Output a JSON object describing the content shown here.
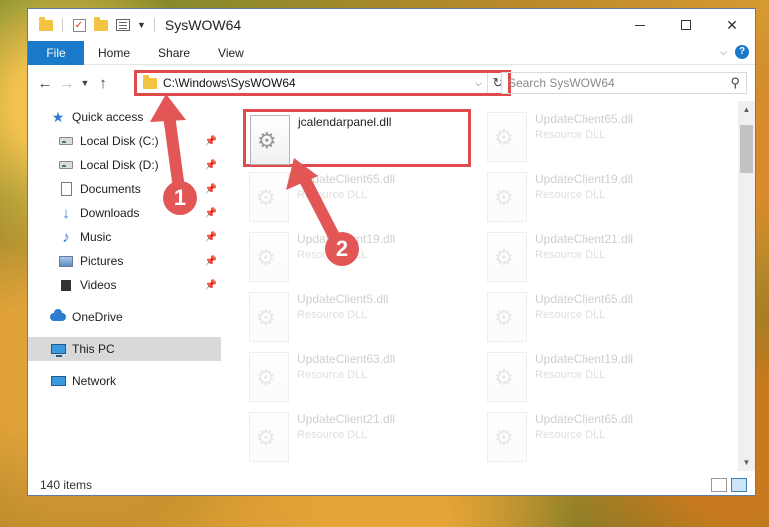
{
  "window": {
    "title": "SysWOW64",
    "minimize_label": "minimize",
    "maximize_label": "maximize",
    "close_label": "✕"
  },
  "ribbon": {
    "file": "File",
    "tabs": [
      "Home",
      "Share",
      "View"
    ]
  },
  "address": {
    "path": "C:\\Windows\\SysWOW64"
  },
  "search": {
    "placeholder": "Search SysWOW64"
  },
  "sidebar": {
    "items": [
      {
        "label": "Quick access",
        "icon": "star-icon"
      },
      {
        "label": "Local Disk (C:)",
        "icon": "drive-icon"
      },
      {
        "label": "Local Disk (D:)",
        "icon": "drive-icon"
      },
      {
        "label": "Documents",
        "icon": "documents-icon"
      },
      {
        "label": "Downloads",
        "icon": "downloads-icon"
      },
      {
        "label": "Music",
        "icon": "music-icon"
      },
      {
        "label": "Pictures",
        "icon": "pictures-icon"
      },
      {
        "label": "Videos",
        "icon": "videos-icon"
      },
      {
        "label": "OneDrive",
        "icon": "onedrive-icon"
      },
      {
        "label": "This PC",
        "icon": "this-pc-icon"
      },
      {
        "label": "Network",
        "icon": "network-icon"
      }
    ]
  },
  "files": {
    "highlighted": {
      "name": "jcalendarpanel.dll",
      "type": ""
    },
    "left_column": [
      {
        "name": "UpdateClient65.dll",
        "type": "Resource DLL"
      },
      {
        "name": "UpdateClient19.dll",
        "type": "Resource DLL"
      },
      {
        "name": "UpdateClient5.dll",
        "type": "Resource DLL"
      },
      {
        "name": "UpdateClient63.dll",
        "type": "Resource DLL"
      },
      {
        "name": "UpdateClient21.dll",
        "type": "Resource DLL"
      }
    ],
    "right_column": [
      {
        "name": "UpdateClient65.dll",
        "type": "Resource DLL"
      },
      {
        "name": "UpdateClient19.dll",
        "type": "Resource DLL"
      },
      {
        "name": "UpdateClient21.dll",
        "type": "Resource DLL"
      },
      {
        "name": "UpdateClient65.dll",
        "type": "Resource DLL"
      },
      {
        "name": "UpdateClient19.dll",
        "type": "Resource DLL"
      },
      {
        "name": "UpdateClient65.dll",
        "type": "Resource DLL"
      }
    ]
  },
  "status": {
    "item_count": "140 items"
  },
  "callouts": {
    "one": "1",
    "two": "2"
  },
  "colors": {
    "accent": "#1979ca",
    "highlight": "#e04a4a",
    "callout": "#e25656"
  }
}
